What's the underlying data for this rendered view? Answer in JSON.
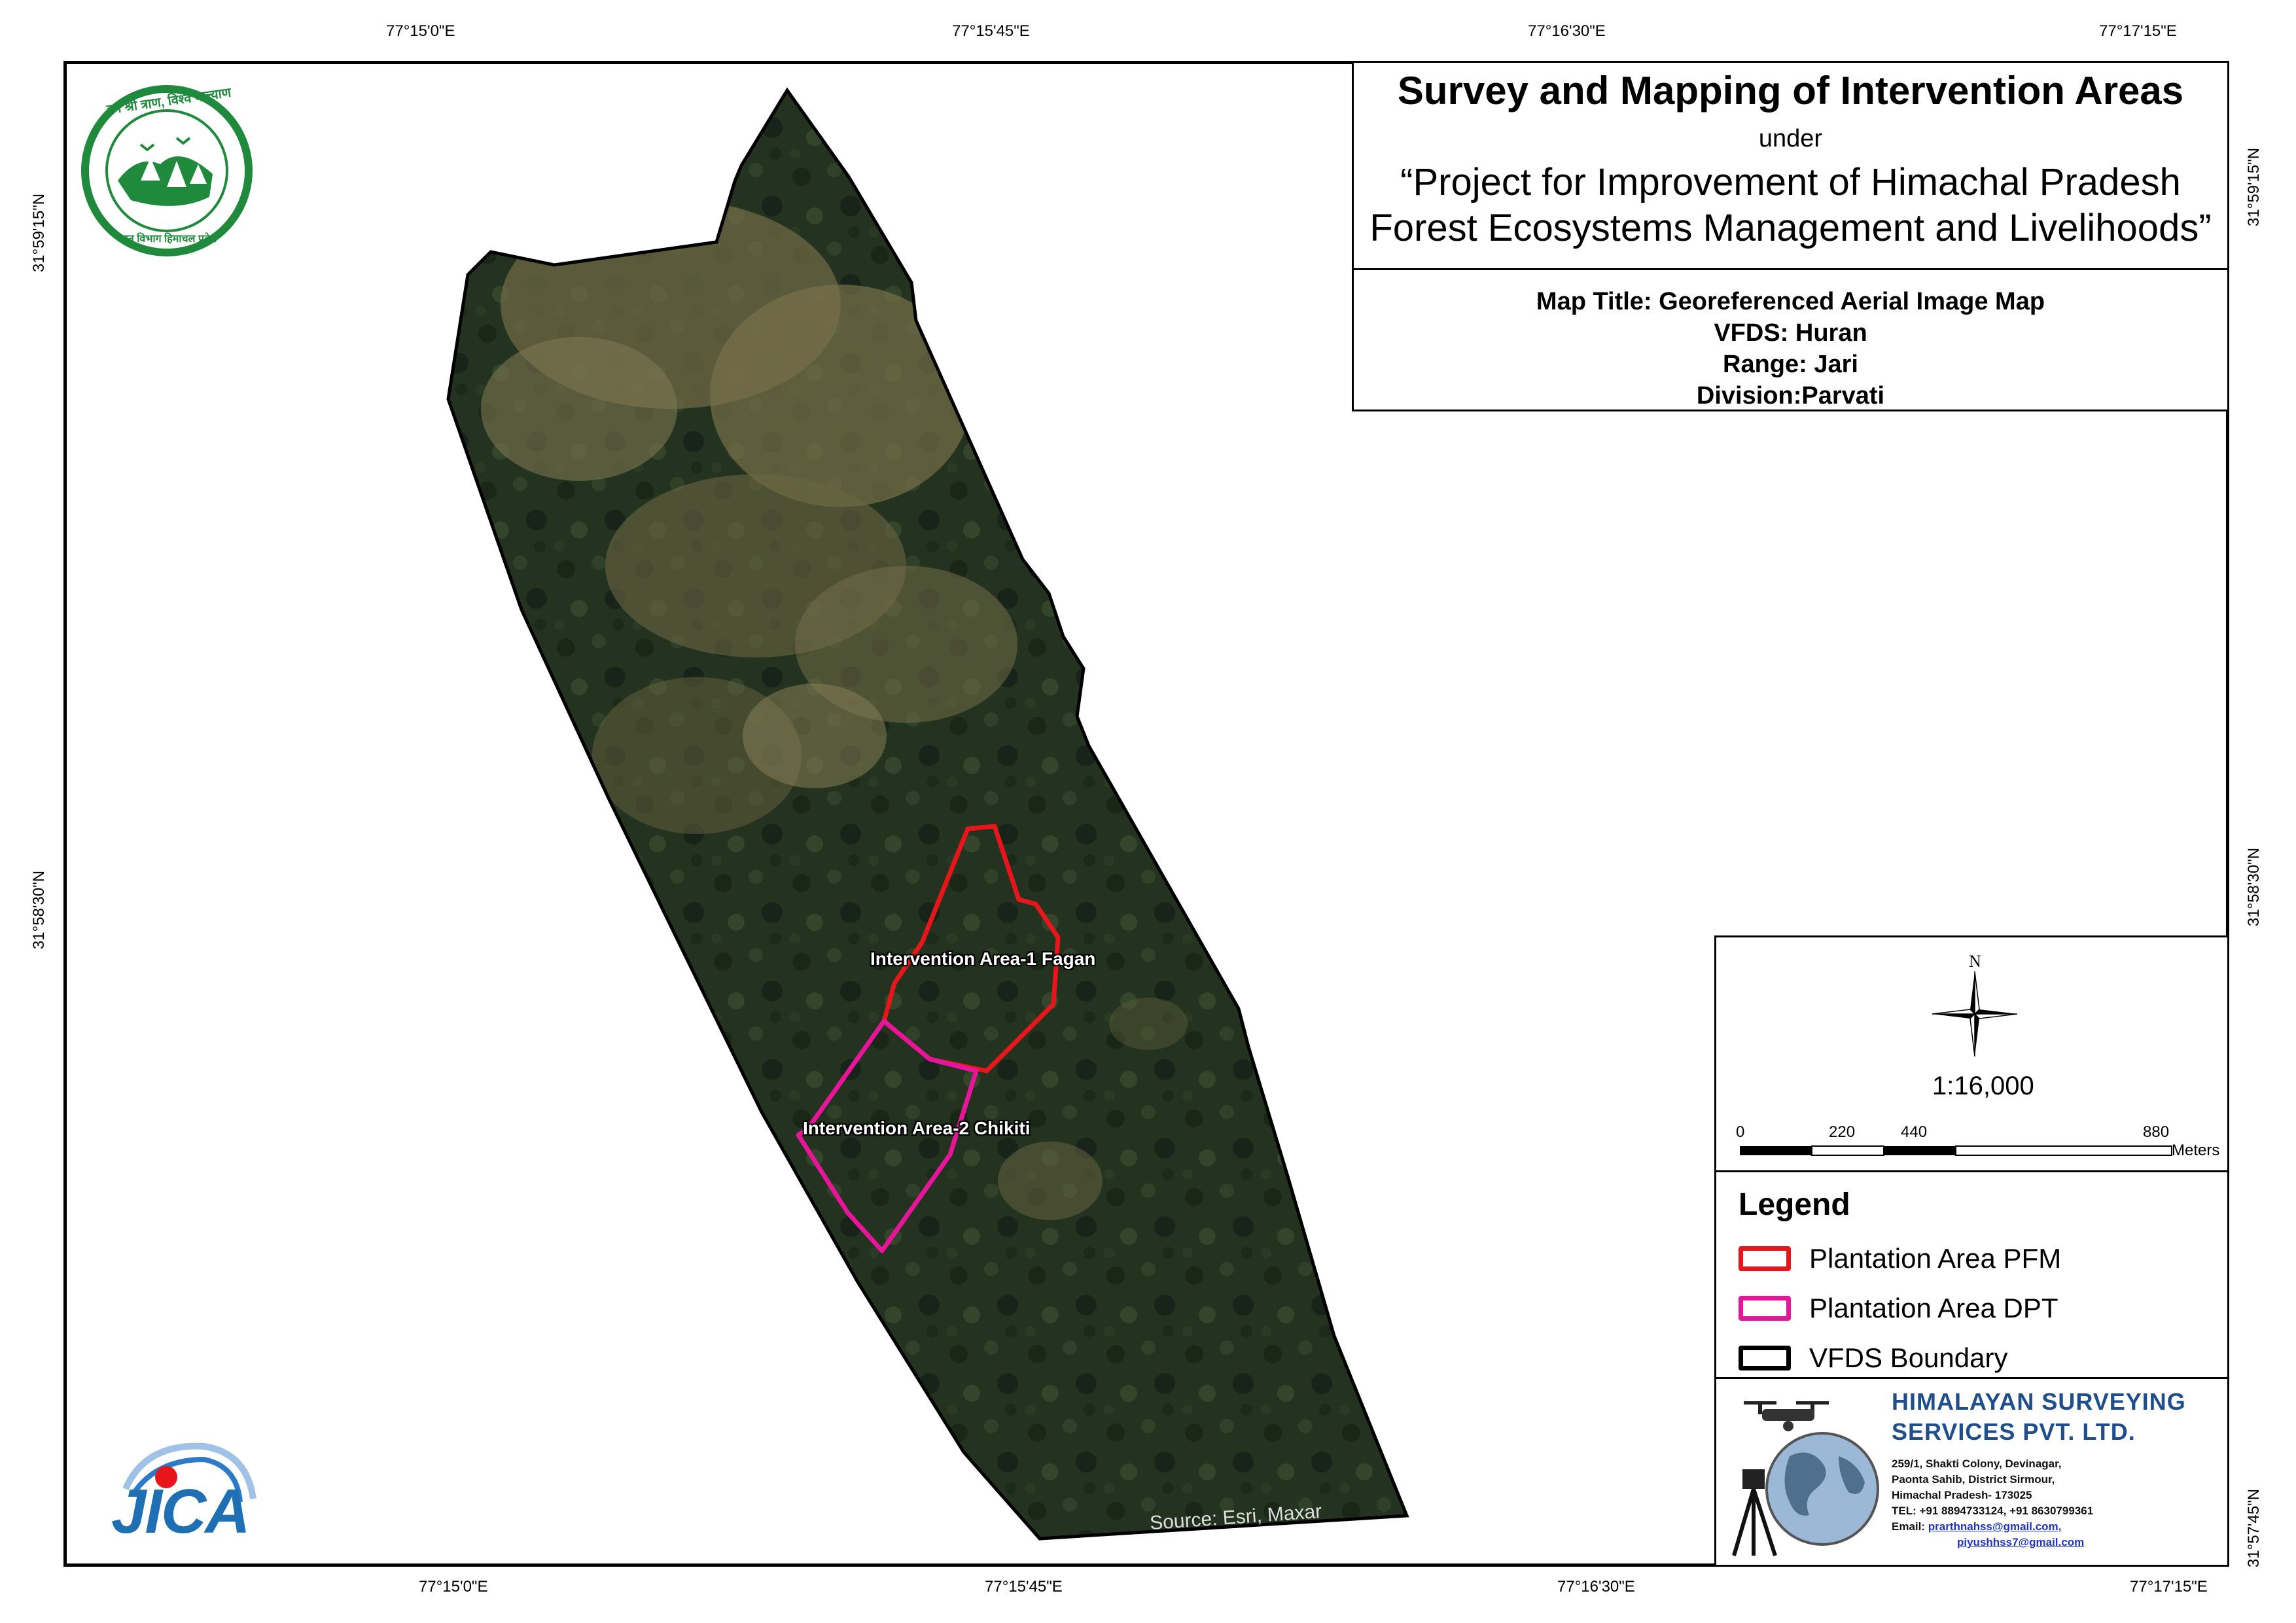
{
  "map": {
    "title": "Survey and Mapping of Intervention Areas",
    "under": "under",
    "project_line1": "“Project for Improvement of Himachal Pradesh",
    "project_line2": "Forest Ecosystems Management and Livelihoods”",
    "map_title": "Map Title: Georeferenced Aerial Image Map",
    "vfds": "VFDS: Huran",
    "range": "Range: Jari",
    "division": "Division:Parvati",
    "source": "Source: Esri, Maxar"
  },
  "graticule": {
    "top": [
      "77°15'0\"E",
      "77°15'45\"E",
      "77°16'30\"E",
      "77°17'15\"E"
    ],
    "bottom": [
      "77°15'0\"E",
      "77°15'45\"E",
      "77°16'30\"E",
      "77°17'15\"E"
    ],
    "left": [
      "31°59'15\"N",
      "31°58'30\"N"
    ],
    "right": [
      "31°59'15\"N",
      "31°58'30\"N",
      "31°57'45\"N"
    ]
  },
  "features": {
    "area1_label": "Intervention Area-1 Fagan",
    "area2_label": "Intervention Area-2 Chikiti"
  },
  "scale": {
    "north": "N",
    "ratio": "1:16,000",
    "ticks": [
      "0",
      "220",
      "440",
      "880"
    ],
    "unit": "Meters"
  },
  "legend": {
    "title": "Legend",
    "items": [
      {
        "label": "Plantation Area PFM",
        "color": "#e8161b"
      },
      {
        "label": "Plantation Area DPT",
        "color": "#e8149a"
      },
      {
        "label": "VFDS Boundary",
        "color": "#000000"
      }
    ]
  },
  "company": {
    "name_line1": "HIMALAYAN SURVEYING",
    "name_line2": "SERVICES PVT. LTD.",
    "addr1": "259/1, Shakti Colony, Devinagar,",
    "addr2": "Paonta Sahib, District Sirmour,",
    "addr3": "Himachal Pradesh- 173025",
    "tel": "TEL: +91 8894733124, +91 8630799361",
    "email_label": "Email:",
    "email1": "prarthnahss@gmail.com,",
    "email2": "piyushhss7@gmail.com"
  },
  "logos": {
    "top_left": "himachal-forest-department-seal",
    "top_left_text": "वन श्री त्राण, विश्व कल्याण",
    "top_left_bottom_text": "वन विभाग हिमाचल प्रदेश",
    "bottom_left": "jica-logo",
    "bottom_left_text": "JICA"
  },
  "colors": {
    "pfm": "#e8161b",
    "dpt": "#e8149a",
    "boundary": "#000000",
    "forest_green": "#1f8a3c",
    "jica_blue": "#1f6fb5",
    "company_blue": "#1f4e8c"
  }
}
